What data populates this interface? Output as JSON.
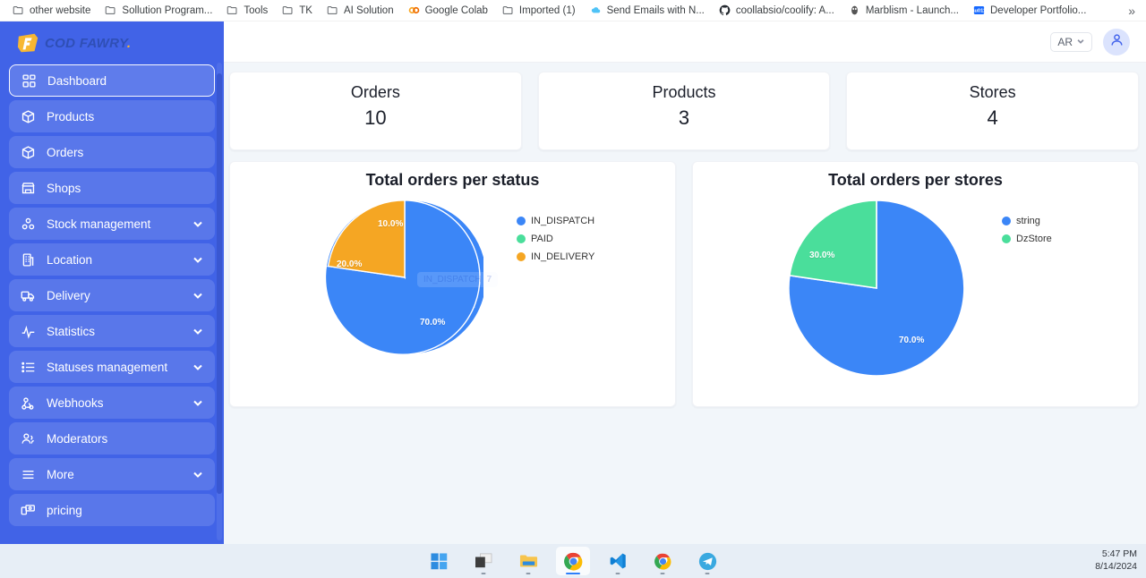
{
  "browser": {
    "bookmarks": [
      {
        "label": "other website",
        "icon": "folder-icon"
      },
      {
        "label": "Sollution Program...",
        "icon": "folder-icon"
      },
      {
        "label": "Tools",
        "icon": "folder-icon"
      },
      {
        "label": "TK",
        "icon": "folder-icon"
      },
      {
        "label": "AI Solution",
        "icon": "folder-icon"
      },
      {
        "label": "Google Colab",
        "icon": "colab-icon"
      },
      {
        "label": "Imported (1)",
        "icon": "folder-icon"
      },
      {
        "label": "Send Emails with N...",
        "icon": "cloud-icon"
      },
      {
        "label": "coollabsio/coolify: A...",
        "icon": "github-icon"
      },
      {
        "label": "Marblism - Launch...",
        "icon": "marblism-icon"
      },
      {
        "label": "Developer Portfolio...",
        "icon": "behance-icon"
      }
    ],
    "overflow_label": "»"
  },
  "sidebar": {
    "logo": {
      "text": "COD FAWRY",
      "dot": "."
    },
    "items": [
      {
        "label": "Dashboard",
        "icon": "grid-icon",
        "active": true,
        "expandable": false
      },
      {
        "label": "Products",
        "icon": "box-icon",
        "active": false,
        "expandable": false
      },
      {
        "label": "Orders",
        "icon": "box-icon",
        "active": false,
        "expandable": false
      },
      {
        "label": "Shops",
        "icon": "store-icon",
        "active": false,
        "expandable": false
      },
      {
        "label": "Stock management",
        "icon": "stack-icon",
        "active": false,
        "expandable": true
      },
      {
        "label": "Location",
        "icon": "building-icon",
        "active": false,
        "expandable": true
      },
      {
        "label": "Delivery",
        "icon": "truck-icon",
        "active": false,
        "expandable": true
      },
      {
        "label": "Statistics",
        "icon": "pulse-icon",
        "active": false,
        "expandable": true
      },
      {
        "label": "Statuses management",
        "icon": "list-icon",
        "active": false,
        "expandable": true
      },
      {
        "label": "Webhooks",
        "icon": "webhook-icon",
        "active": false,
        "expandable": true
      },
      {
        "label": "Moderators",
        "icon": "users-icon",
        "active": false,
        "expandable": false
      },
      {
        "label": "More",
        "icon": "menu-icon",
        "active": false,
        "expandable": true
      },
      {
        "label": "pricing",
        "icon": "pricing-icon",
        "active": false,
        "expandable": false
      }
    ]
  },
  "topbar": {
    "language": "AR",
    "chevron_icon": "chevron-down-icon",
    "avatar_icon": "user-icon"
  },
  "stats": [
    {
      "title": "Orders",
      "value": "10"
    },
    {
      "title": "Products",
      "value": "3"
    },
    {
      "title": "Stores",
      "value": "4"
    }
  ],
  "colors": {
    "sidebar": "#4163e7",
    "blue": "#3b86f7",
    "green": "#4ade9b",
    "orange": "#f5a623",
    "page_bg": "#f2f6fa"
  },
  "chart_data": [
    {
      "type": "pie",
      "title": "Total orders per status",
      "categories": [
        "IN_DISPATCH",
        "PAID",
        "IN_DELIVERY"
      ],
      "values": [
        70.0,
        20.0,
        10.0
      ],
      "labels": [
        "70.0%",
        "20.0%",
        "10.0%"
      ],
      "colors": [
        "#3b86f7",
        "#4ade9b",
        "#f5a623"
      ],
      "legend_position": "right",
      "tooltip": {
        "label": "IN_DISPATCH",
        "value": "7"
      }
    },
    {
      "type": "pie",
      "title": "Total orders per stores",
      "categories": [
        "string",
        "DzStore"
      ],
      "values": [
        70.0,
        30.0
      ],
      "labels": [
        "70.0%",
        "30.0%"
      ],
      "colors": [
        "#3b86f7",
        "#4ade9b"
      ],
      "legend_position": "right"
    }
  ],
  "taskbar": {
    "buttons": [
      {
        "name": "start-button",
        "icon": "windows-icon",
        "active": false
      },
      {
        "name": "task-view-button",
        "icon": "task-view-icon",
        "active": false
      },
      {
        "name": "file-explorer-button",
        "icon": "folder-icon",
        "active": false
      },
      {
        "name": "chrome-button",
        "icon": "chrome-icon",
        "active": true
      },
      {
        "name": "vscode-button",
        "icon": "vscode-icon",
        "active": false
      },
      {
        "name": "chrome-2-button",
        "icon": "chrome-icon",
        "active": false
      },
      {
        "name": "telegram-button",
        "icon": "telegram-icon",
        "active": false
      }
    ],
    "time": "5:47 PM",
    "date": "8/14/2024"
  }
}
